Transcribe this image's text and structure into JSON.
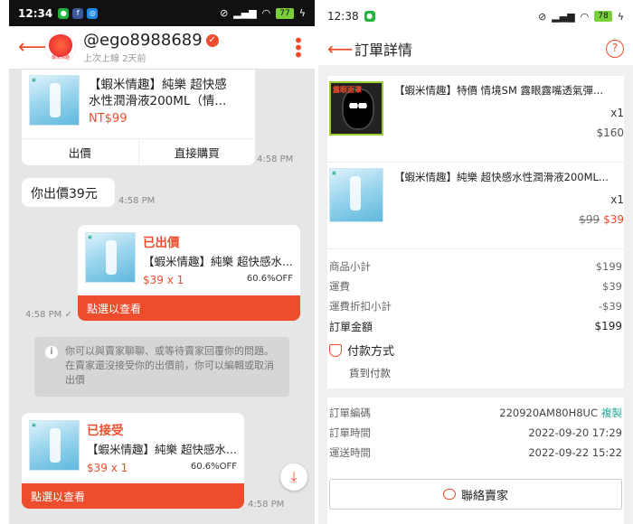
{
  "left": {
    "status": {
      "time": "12:34",
      "battery": "77"
    },
    "header": {
      "username": "@ego8988689",
      "last_seen": "上次上線 2天前",
      "avatar_label": "蝦米情趣"
    },
    "product_card": {
      "title_line1": "【蝦米情趣】純樂 超快感",
      "title_line2": "水性潤滑液200ML（情...",
      "price": "NT$99",
      "offer_button": "出價",
      "buy_button": "直接購買",
      "time": "4:58 PM"
    },
    "my_offer_bubble": {
      "text": "你出價39元",
      "time": "4:58 PM"
    },
    "offered_card": {
      "status": "已出價",
      "title": "【蝦米情趣】純樂 超快感水...",
      "price": "$39 x 1",
      "discount": "60.6%OFF",
      "action": "點選以查看",
      "time": "4:58 PM ✓"
    },
    "notice": {
      "text": "你可以與賣家聊聊、或等待賣家回覆你的問題。在賣家還沒接受你的出價前，你可以編輯或取消出價"
    },
    "accepted_card": {
      "status": "已接受",
      "title": "【蝦米情趣】純樂 超快感水...",
      "price": "$39 x 1",
      "discount": "60.6%OFF",
      "action": "點選以查看",
      "time": "4:58 PM"
    }
  },
  "right": {
    "status": {
      "time": "12:38",
      "battery": "78"
    },
    "header": {
      "title": "訂單詳情",
      "help": "?"
    },
    "items": [
      {
        "title": "【蝦米情趣】特價 情境SM 露眼露嘴透氣彈...",
        "qty": "x1",
        "price": "$160",
        "img_label": "露眼面罩"
      },
      {
        "title": "【蝦米情趣】純樂 超快感水性潤滑液200ML...",
        "qty": "x1",
        "old_price": "$99",
        "new_price": "$39"
      }
    ],
    "summary": [
      {
        "label": "商品小計",
        "value": "$199"
      },
      {
        "label": "運費",
        "value": "$39"
      },
      {
        "label": "運費折扣小計",
        "value": "-$39"
      }
    ],
    "total": {
      "label": "訂單金額",
      "value": "$199"
    },
    "payment": {
      "title": "付款方式",
      "method": "貨到付款"
    },
    "meta": {
      "order_no_label": "訂單編碼",
      "order_no": "220920AM80H8UC",
      "copy": "複製",
      "order_time_label": "訂單時間",
      "order_time": "2022-09-20 17:29",
      "ship_time_label": "運送時間",
      "ship_time": "2022-09-22 15:22"
    },
    "contact": {
      "label": "聯絡賣家"
    }
  },
  "colors": {
    "accent": "#ee4d2d",
    "copy_link": "#26aa99"
  }
}
